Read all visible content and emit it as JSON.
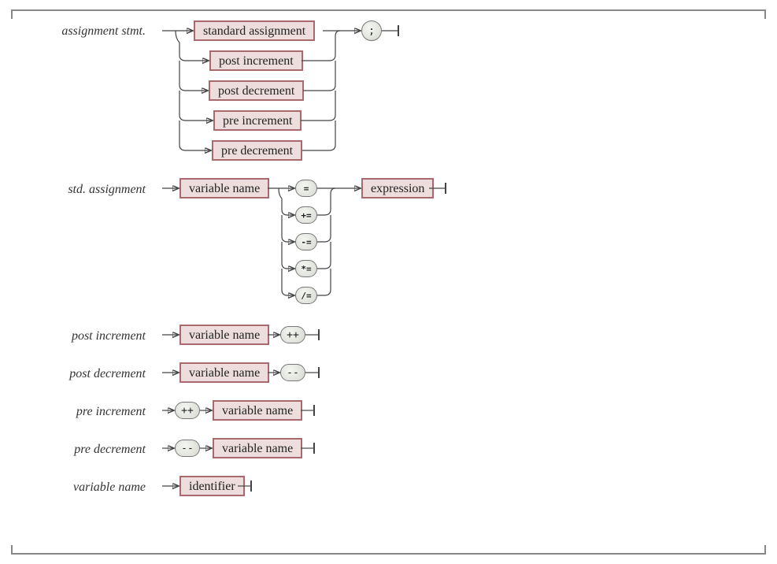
{
  "rules": {
    "r1": {
      "label": "assignment stmt."
    },
    "r2": {
      "label": "std. assignment"
    },
    "r3": {
      "label": "post increment"
    },
    "r4": {
      "label": "post decrement"
    },
    "r5": {
      "label": "pre increment"
    },
    "r6": {
      "label": "pre decrement"
    },
    "r7": {
      "label": "variable name"
    }
  },
  "nonterminals": {
    "standard_assignment": "standard assignment",
    "post_increment": "post increment",
    "post_decrement": "post decrement",
    "pre_increment": "pre increment",
    "pre_decrement": "pre decrement",
    "variable_name": "variable name",
    "expression": "expression",
    "identifier": "identifier"
  },
  "terminals": {
    "semicolon": ";",
    "eq": "=",
    "pluseq": "+=",
    "minuseq": "-=",
    "stareq": "*=",
    "slasheq": "/=",
    "pluspplus": "++",
    "minusminus": "--"
  },
  "chart_data": {
    "type": "railroad-diagram",
    "grammar": {
      "assignment_stmt": {
        "seq": [
          {
            "choice": [
              "standard_assignment",
              "post_increment",
              "post_decrement",
              "pre_increment",
              "pre_decrement"
            ]
          },
          {
            "terminal": ";"
          }
        ]
      },
      "std_assignment": {
        "seq": [
          "variable_name",
          {
            "choice_terminals": [
              "=",
              "+=",
              "-=",
              "*=",
              "/="
            ]
          },
          "expression"
        ]
      },
      "post_increment": {
        "seq": [
          "variable_name",
          {
            "terminal": "++"
          }
        ]
      },
      "post_decrement": {
        "seq": [
          "variable_name",
          {
            "terminal": "--"
          }
        ]
      },
      "pre_increment": {
        "seq": [
          {
            "terminal": "++"
          },
          "variable_name"
        ]
      },
      "pre_decrement": {
        "seq": [
          {
            "terminal": "--"
          },
          "variable_name"
        ]
      },
      "variable_name": {
        "seq": [
          "identifier"
        ]
      }
    }
  }
}
